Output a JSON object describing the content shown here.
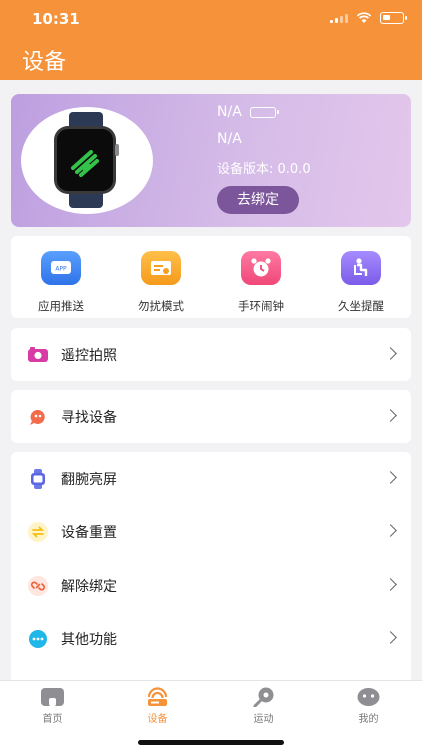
{
  "status_bar": {
    "time": "10:31"
  },
  "header": {
    "title": "设备"
  },
  "device": {
    "name": "N/A",
    "id": "N/A",
    "version": "设备版本: 0.0.0",
    "bind_button": "去绑定"
  },
  "quick_actions": [
    {
      "label": "应用推送",
      "icon": "app-push-icon",
      "color": "#3f86f0"
    },
    {
      "label": "勿扰模式",
      "icon": "do-not-disturb-icon",
      "color": "#f7a62c"
    },
    {
      "label": "手环闹钟",
      "icon": "alarm-clock-icon",
      "color": "#f25a86"
    },
    {
      "label": "久坐提醒",
      "icon": "sedentary-reminder-icon",
      "color": "#8a6cf0"
    }
  ],
  "menu": {
    "remote_photo": "遥控拍照",
    "find_device": "寻找设备",
    "wrist_wake": "翻腕亮屏",
    "device_reset": "设备重置",
    "unbind": "解除绑定",
    "other_functions": "其他功能"
  },
  "tabbar": [
    {
      "label": "首页",
      "icon": "home-icon",
      "active": false
    },
    {
      "label": "设备",
      "icon": "device-icon",
      "active": true
    },
    {
      "label": "运动",
      "icon": "sport-icon",
      "active": false
    },
    {
      "label": "我的",
      "icon": "profile-icon",
      "active": false
    }
  ],
  "colors": {
    "accent": "#f5923a",
    "bind_button": "#7c569a"
  }
}
